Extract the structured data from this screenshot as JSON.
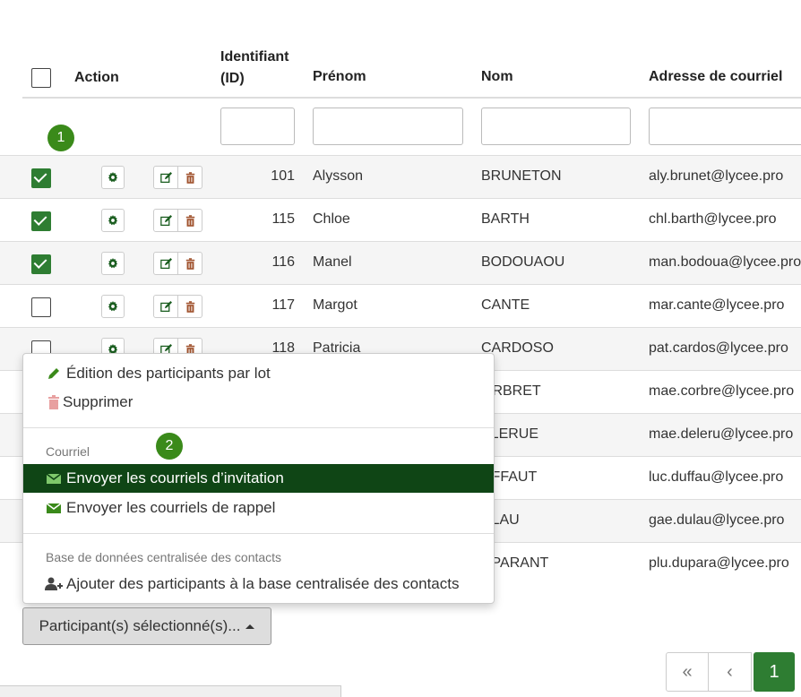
{
  "header": {
    "action": "Action",
    "id_line1": "Identifiant",
    "id_line2": "(ID)",
    "firstname": "Prénom",
    "lastname": "Nom",
    "email": "Adresse de courriel"
  },
  "badges": {
    "one": "1",
    "two": "2"
  },
  "rows": [
    {
      "id": "101",
      "first": "Alysson",
      "last": "BRUNETON",
      "email": "aly.brunet@lycee.pro",
      "checked": true
    },
    {
      "id": "115",
      "first": "Chloe",
      "last": "BARTH",
      "email": "chl.barth@lycee.pro",
      "checked": true
    },
    {
      "id": "116",
      "first": "Manel",
      "last": "BODOUAOU",
      "email": "man.bodoua@lycee.pro",
      "checked": true
    },
    {
      "id": "117",
      "first": "Margot",
      "last": "CANTE",
      "email": "mar.cante@lycee.pro",
      "checked": false
    },
    {
      "id": "118",
      "first": "Patricia",
      "last": "CARDOSO",
      "email": "pat.cardos@lycee.pro",
      "checked": false
    },
    {
      "id": "",
      "first": "",
      "last": "ORBRET",
      "email": "mae.corbre@lycee.pro",
      "checked": false
    },
    {
      "id": "",
      "first": "",
      "last": "ELERUE",
      "email": "mae.deleru@lycee.pro",
      "checked": false
    },
    {
      "id": "",
      "first": "",
      "last": "UFFAUT",
      "email": "luc.duffau@lycee.pro",
      "checked": false
    },
    {
      "id": "",
      "first": "",
      "last": "ULAU",
      "email": "gae.dulau@lycee.pro",
      "checked": false
    },
    {
      "id": "",
      "first": "",
      "last": "UPARANT",
      "email": "plu.dupara@lycee.pro",
      "checked": false
    }
  ],
  "menu": {
    "batch_edit": "Édition des participants par lot",
    "delete": "Supprimer",
    "section_email": "Courriel",
    "send_invite": "Envoyer les courriels d’invitation",
    "send_reminder": "Envoyer les courriels de rappel",
    "section_db": "Base de données centralisée des contacts",
    "add_to_db": "Ajouter des participants à la base centralisée des contacts"
  },
  "selected_button": "Participant(s) sélectionné(s)...",
  "pagination": {
    "first": "«",
    "prev": "‹",
    "current": "1"
  },
  "colors": {
    "accent": "#2e7d32",
    "menu_active": "#0f4515",
    "badge": "#3a8a1a"
  }
}
